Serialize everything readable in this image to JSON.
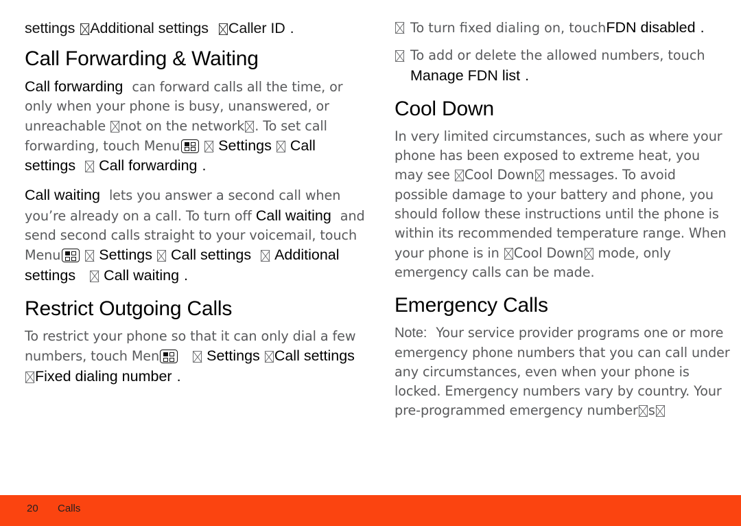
{
  "document": {
    "page_number": "20",
    "section_name": "Calls",
    "footer_color": "#fb4410",
    "body_text_color": "#58595b",
    "emphasis_text_color": "#000000"
  },
  "left_column": {
    "continued_paragraph": {
      "run_1": "settings",
      "run_2": "Additional settings",
      "run_3": "Caller ID",
      "run_4": "."
    },
    "heading_1": "Call Forwarding & Waiting",
    "para_forwarding": {
      "term": "Call forwarding",
      "text_1": "can forward calls all the time, or only when your phone is busy, unanswered, or unreachable",
      "text_2": "not on the network",
      "text_3": ". To set call forwarding, touch",
      "menu_label": "Menu",
      "path_1": "Settings",
      "path_2": "Call settings",
      "path_3": "Call forwarding",
      "period": "."
    },
    "para_waiting": {
      "term": "Call waiting",
      "text_1": "lets you answer a second call when you’re already on a call. To turn off",
      "term_2": "Call waiting",
      "text_2": "and send second calls straight to your voicemail, touch",
      "menu_label": "Menu",
      "path_1": "Settings",
      "path_2": "Call settings",
      "path_3": "Additional settings",
      "path_4": "Call waiting",
      "period": "."
    },
    "heading_2": "Restrict Outgoing Calls",
    "para_restrict": {
      "text_1": "To restrict your phone so that it can only dial a few numbers, touch",
      "menu_label": "Menu",
      "path_1": "Settings",
      "path_2": "Call settings",
      "path_3": "Fixed dialing number",
      "period": "."
    }
  },
  "right_column": {
    "bullets": [
      {
        "text_1": "To turn fixed dialing on, touch",
        "term": "FDN disabled",
        "period": "."
      },
      {
        "text_1": "To add or delete the allowed numbers, touch",
        "term": "Manage FDN list",
        "period": "."
      }
    ],
    "heading_1": "Cool Down",
    "para_cool_down": {
      "text_1": "In very limited circumstances, such as where your phone has been exposed to extreme heat, you may see",
      "quoted_1": "Cool Down",
      "text_2": "messages. To avoid possible damage to your battery and phone, you should follow these instructions until the phone is within its recommended temperature range. When your phone is in",
      "quoted_2": "Cool Down",
      "text_3": "mode, only emergency calls can be made."
    },
    "heading_2": "Emergency Calls",
    "para_emergency": {
      "note_label": "Note:",
      "text_1": "Your service provider programs one or more emergency phone numbers that you can call under any circumstances, even when your phone is locked. Emergency numbers vary by country. Your pre-programmed emergency number",
      "text_2": "s"
    }
  },
  "icons": {
    "menu_key": "menu-key-icon",
    "missing_glyph": "missing-glyph-box"
  }
}
